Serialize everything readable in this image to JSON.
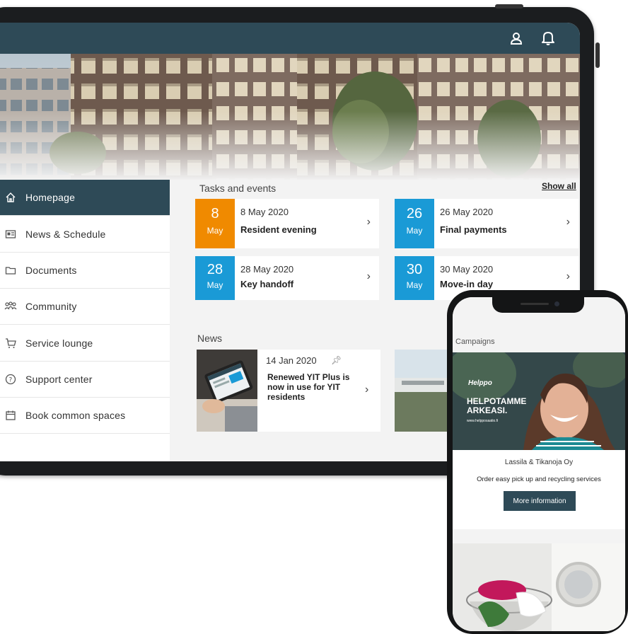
{
  "header": {
    "user_icon": "user-icon",
    "bell_icon": "bell-icon"
  },
  "sidebar": {
    "items": [
      {
        "label": "Homepage",
        "icon": "home-icon",
        "active": true
      },
      {
        "label": "News & Schedule",
        "icon": "calendar-news-icon"
      },
      {
        "label": "Documents",
        "icon": "folder-icon"
      },
      {
        "label": "Community",
        "icon": "people-icon"
      },
      {
        "label": "Service lounge",
        "icon": "cart-icon"
      },
      {
        "label": "Support center",
        "icon": "help-icon"
      },
      {
        "label": "Book common spaces",
        "icon": "calendar-icon"
      }
    ]
  },
  "tasks": {
    "title": "Tasks and events",
    "show_all": "Show all",
    "items": [
      {
        "day": "8",
        "month": "May",
        "date": "8 May 2020",
        "title": "Resident evening",
        "color": "#f08a00"
      },
      {
        "day": "26",
        "month": "May",
        "date": "26 May 2020",
        "title": "Final payments",
        "color": "#1a9ad6"
      },
      {
        "day": "28",
        "month": "May",
        "date": "28 May 2020",
        "title": "Key handoff",
        "color": "#1a9ad6"
      },
      {
        "day": "30",
        "month": "May",
        "date": "30 May 2020",
        "title": "Move-in day",
        "color": "#1a9ad6"
      }
    ]
  },
  "news": {
    "title": "News",
    "items": [
      {
        "date": "14 Jan 2020",
        "title": "Renewed YIT Plus is now in use for YIT residents"
      }
    ]
  },
  "phone": {
    "campaigns_title": "Campaigns",
    "ad_brand": "Helppo",
    "ad_headline_1": "HELPOTAMME",
    "ad_headline_2": "ARKEASI.",
    "ad_url": "www.helpposaatio.fi",
    "company": "Lassila & Tikanoja Oy",
    "description": "Order easy pick up and recycling services",
    "button": "More information"
  },
  "colors": {
    "header": "#2e4a57",
    "orange": "#f08a00",
    "blue": "#1a9ad6"
  }
}
